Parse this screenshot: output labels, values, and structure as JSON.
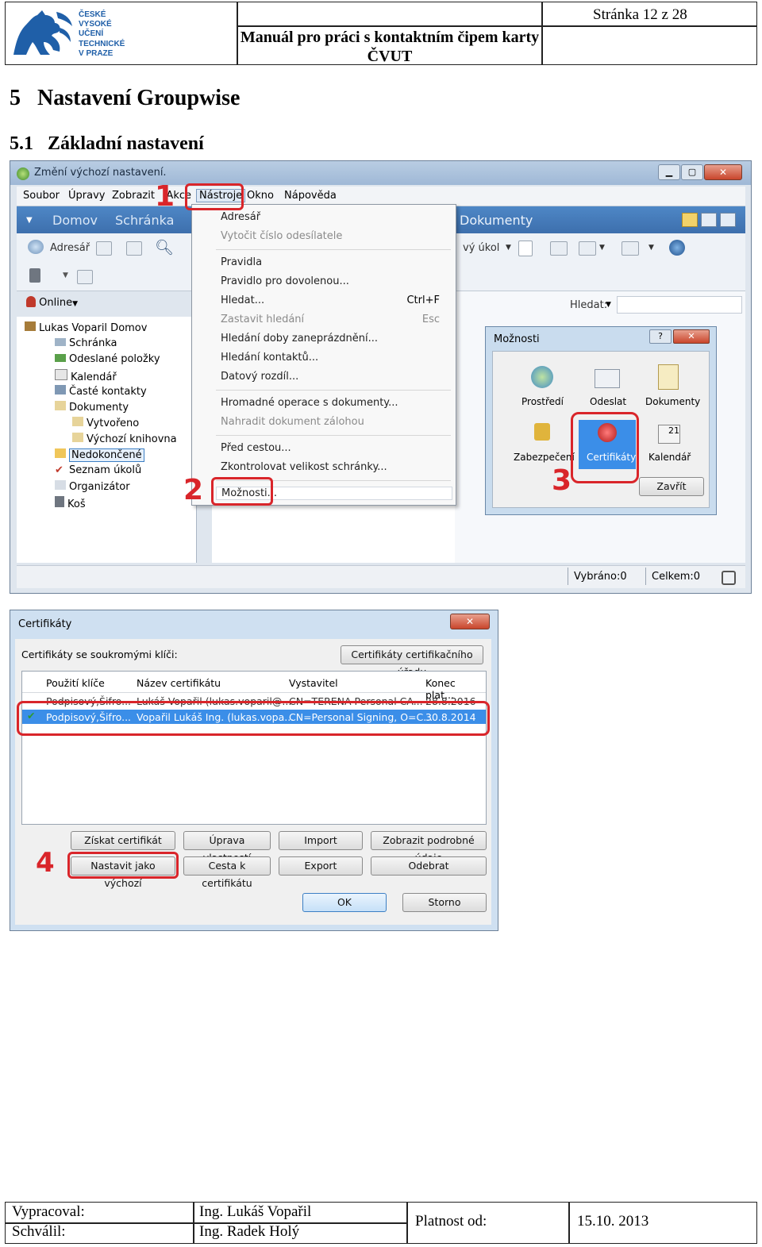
{
  "header": {
    "logo_lines": [
      "ČESKÉ",
      "VYSOKÉ",
      "UČENÍ",
      "TECHNICKÉ",
      "V PRAZE"
    ],
    "manual_title": "Manuál pro práci s kontaktním čipem karty ČVUT",
    "page": "Stránka 12 z 28"
  },
  "section": {
    "number": "5",
    "title": "Nastavení Groupwise"
  },
  "subsection": {
    "number": "5.1",
    "title": "Základní nastavení"
  },
  "groupwise": {
    "window_title": "Změní výchozí nastavení.",
    "menubar": [
      "Soubor",
      "Úpravy",
      "Zobrazit",
      "Akce",
      "Nástroje",
      "Okno",
      "Nápověda"
    ],
    "tabs": [
      "Domov",
      "Schránka",
      "Dokumenty"
    ],
    "toolbar": {
      "addressbook": "Adresář",
      "task_fragment": "vý úkol"
    },
    "online": "Online",
    "search_label": "Hledat:",
    "tree": [
      "Lukas Voparil Domov",
      "Schránka",
      "Odeslané položky",
      "Kalendář",
      "Časté kontakty",
      "Dokumenty",
      "Vytvořeno",
      "Výchozí knihovna",
      "Nedokončené",
      "Seznam úkolů",
      "Organizátor",
      "Koš"
    ],
    "tools_menu": {
      "items": [
        {
          "label": "Adresář",
          "shortcut": "",
          "disabled": false
        },
        {
          "label": "Vytočit číslo odesílatele",
          "shortcut": "",
          "disabled": true
        },
        {
          "label": "Pravidla",
          "shortcut": "",
          "disabled": false
        },
        {
          "label": "Pravidlo pro dovolenou...",
          "shortcut": "",
          "disabled": false
        },
        {
          "label": "Hledat...",
          "shortcut": "Ctrl+F",
          "disabled": false
        },
        {
          "label": "Zastavit hledání",
          "shortcut": "Esc",
          "disabled": true
        },
        {
          "label": "Hledání doby zaneprázdnění...",
          "shortcut": "",
          "disabled": false
        },
        {
          "label": "Hledání kontaktů...",
          "shortcut": "",
          "disabled": false
        },
        {
          "label": "Datový rozdíl...",
          "shortcut": "",
          "disabled": false
        },
        {
          "label": "Hromadné operace s dokumenty...",
          "shortcut": "",
          "disabled": false
        },
        {
          "label": "Nahradit dokument zálohou",
          "shortcut": "",
          "disabled": true
        },
        {
          "label": "Před cestou...",
          "shortcut": "",
          "disabled": false
        },
        {
          "label": "Zkontrolovat velikost schránky...",
          "shortcut": "",
          "disabled": false
        },
        {
          "label": "Možnosti...",
          "shortcut": "",
          "disabled": false
        }
      ]
    },
    "options_dialog": {
      "title": "Možnosti",
      "icons": [
        "Prostředí",
        "Odeslat",
        "Dokumenty",
        "Zabezpečení",
        "Certifikáty",
        "Kalendář"
      ],
      "close_button": "Zavřít"
    },
    "status": {
      "selected": "Vybráno:0",
      "total": "Celkem:0"
    }
  },
  "certificates": {
    "title": "Certifikáty",
    "private_keys_label": "Certifikáty se soukromými klíči:",
    "ca_button": "Certifikáty certifikačního úřadu",
    "columns": [
      "Použití klíče",
      "Název certifikátu",
      "Vystavitel",
      "Konec plat..."
    ],
    "rows": [
      [
        "Podpisový,Šifro...",
        "Lukáš Vopařil (lukas.voparil@...",
        "CN=TERENA Personal CA...",
        "28.8.2016"
      ],
      [
        "Podpisový,Šifro...",
        "Vopařil Lukáš Ing. (lukas.vopa...",
        "CN=Personal Signing, O=C...",
        "30.8.2014"
      ]
    ],
    "buttons": {
      "get": "Získat certifikát",
      "edit": "Úprava vlastností",
      "import": "Import",
      "details": "Zobrazit podrobné údaje",
      "set_default": "Nastavit jako výchozí",
      "path": "Cesta k certifikátu",
      "export": "Export",
      "remove": "Odebrat",
      "ok": "OK",
      "cancel": "Storno"
    }
  },
  "markers": [
    "1",
    "2",
    "3",
    "4"
  ],
  "footer": {
    "prepared_label": "Vypracoval:",
    "prepared_by": "Ing. Lukáš Vopařil",
    "approved_label": "Schválil:",
    "approved_by": "Ing. Radek Holý",
    "valid_label": "Platnost od:",
    "valid_from": "15.10. 2013"
  },
  "colors": {
    "accent_red": "#d9252a",
    "logo_blue": "#1f5fa8",
    "selection_blue": "#3b8ee8"
  }
}
